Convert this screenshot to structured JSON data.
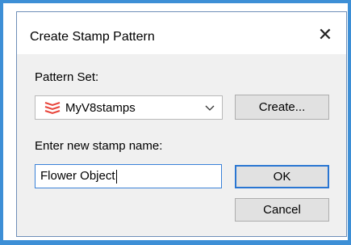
{
  "dialog": {
    "title": "Create Stamp Pattern",
    "close_icon": "close-icon"
  },
  "pattern_set": {
    "label": "Pattern Set:",
    "selected": "MyV8stamps",
    "icon": "stamp-pattern-icon",
    "icon_color": "#e8443a",
    "create_label": "Create..."
  },
  "stamp_name": {
    "label": "Enter new stamp name:",
    "value": "Flower Object"
  },
  "buttons": {
    "ok": "OK",
    "cancel": "Cancel"
  },
  "colors": {
    "accent": "#2a76d2",
    "window_edge": "#3d8fd6"
  }
}
